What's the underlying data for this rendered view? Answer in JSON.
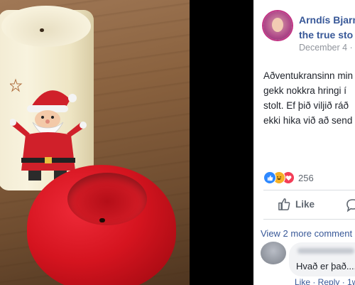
{
  "post": {
    "author_line1": "Arndís Bjarn",
    "author_line2": "the true sto",
    "date": "December 4 ·",
    "body_lines": [
      "Aðventukransinn min",
      "gekk nokkra hringi í",
      "stolt. Ef þið viljið ráð",
      "ekki hika við að send"
    ],
    "reaction_count": "256",
    "like_label": "Like",
    "view_more": "View 2 more comment",
    "comment_text": "Hvað er það....",
    "comment_actions": "Like · Reply · 1w"
  },
  "icons": {
    "reactions": [
      "like-reaction-icon",
      "haha-reaction-icon",
      "love-reaction-icon"
    ]
  },
  "colors": {
    "link_blue": "#385898",
    "reaction_like": "#2d88ff",
    "reaction_haha": "#f7b125",
    "reaction_love": "#f33e58"
  }
}
